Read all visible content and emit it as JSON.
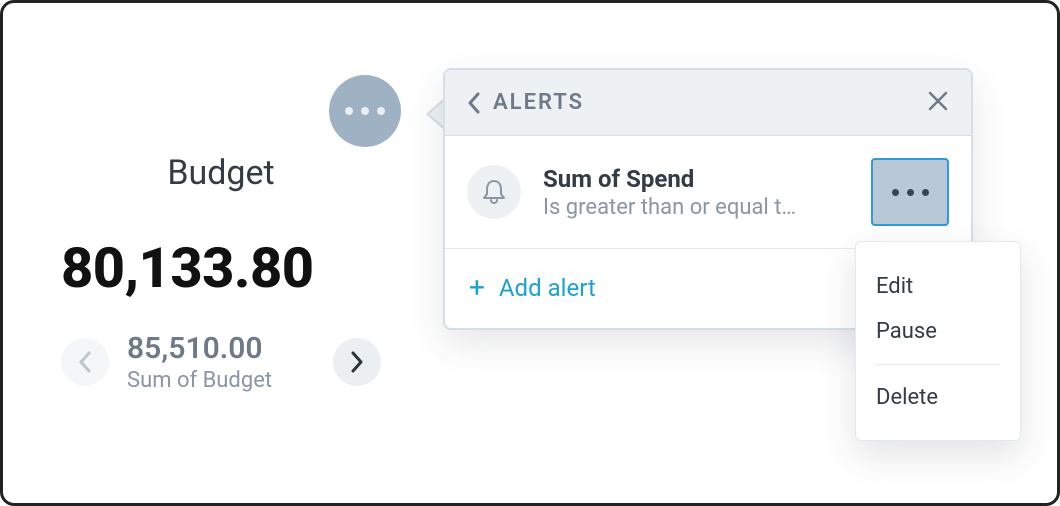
{
  "budget": {
    "title": "Budget",
    "value": "80,133.80",
    "secondary_value": "85,510.00",
    "secondary_label": "Sum of Budget"
  },
  "popover": {
    "title": "ALERTS",
    "alert": {
      "title": "Sum of Spend",
      "condition": "Is greater than or equal t…"
    },
    "add_label": "Add alert"
  },
  "menu": {
    "edit": "Edit",
    "pause": "Pause",
    "delete": "Delete"
  },
  "colors": {
    "accent": "#1da1d2",
    "muted": "#8a96a3"
  }
}
